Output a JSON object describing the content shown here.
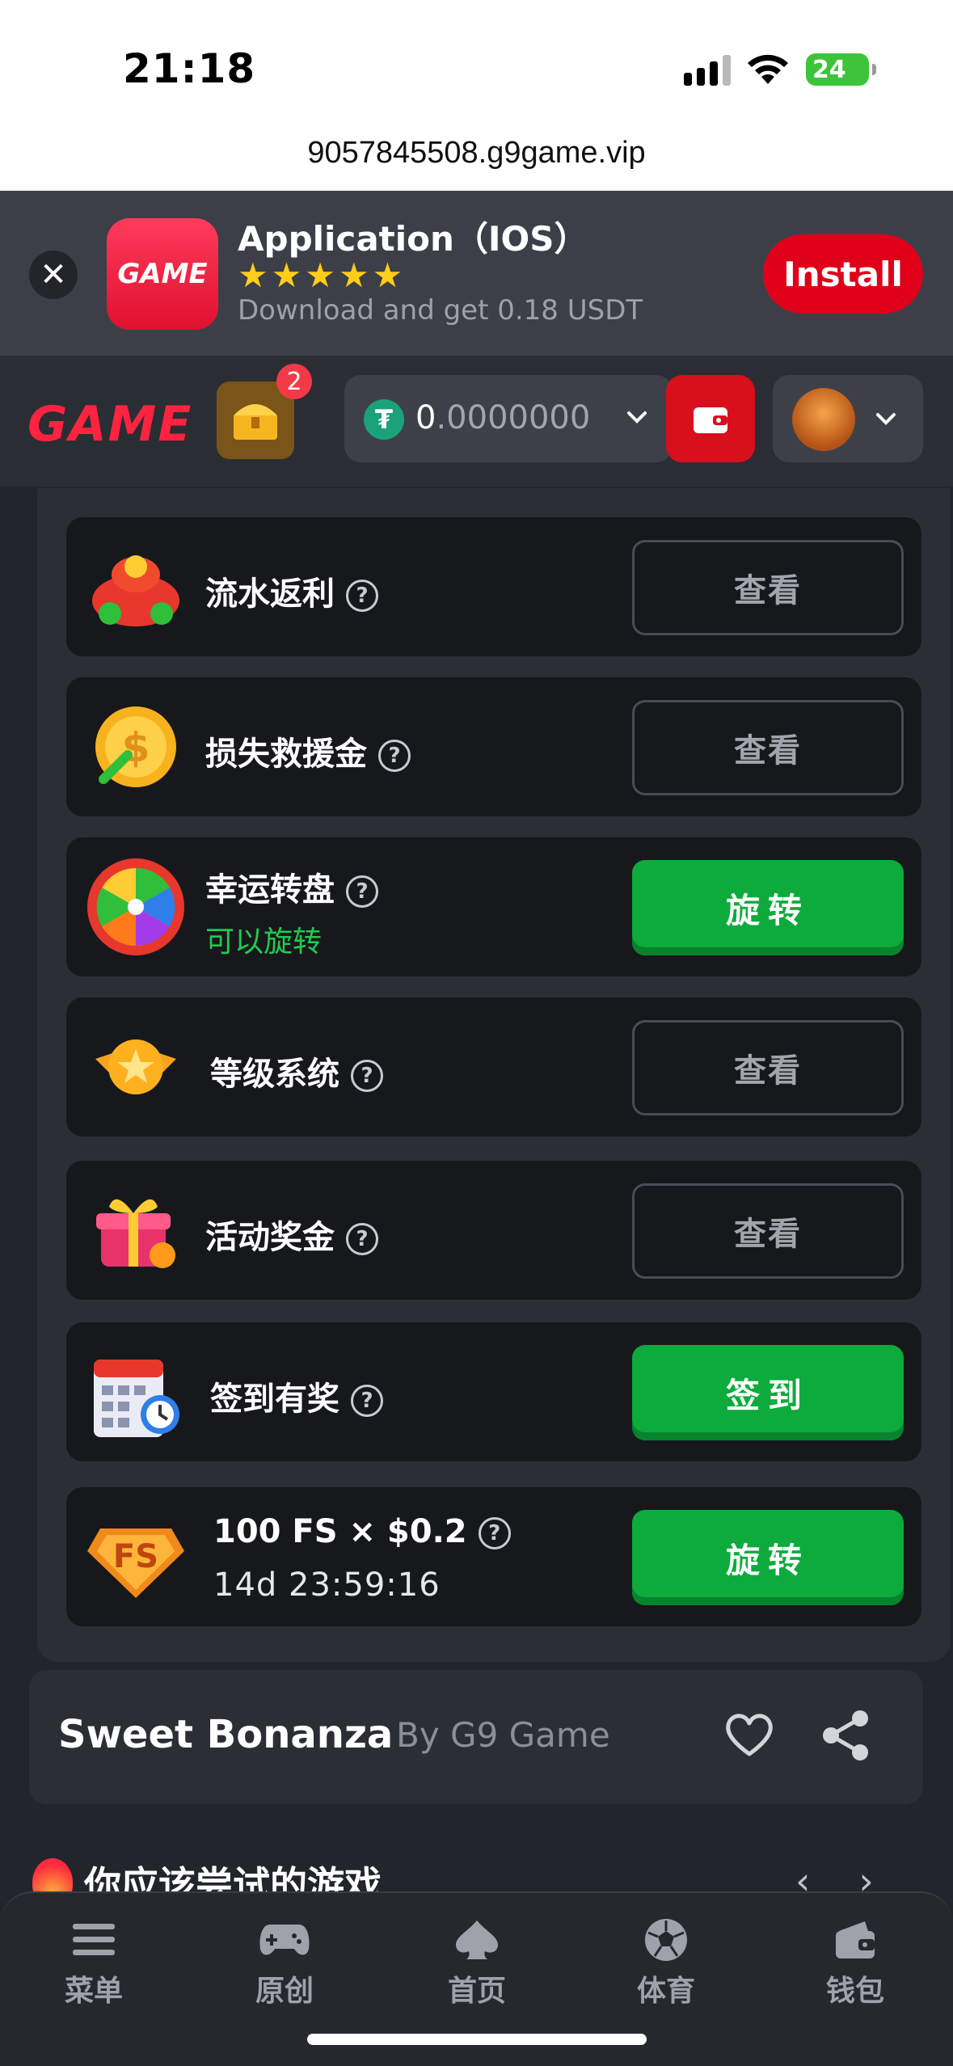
{
  "status_bar": {
    "time": "21:18",
    "battery": "24"
  },
  "url_bar": {
    "url": "9057845508.g9game.vip"
  },
  "install_banner": {
    "icon_text": "GAME",
    "title": "Application（IOS）",
    "stars": "★★★★★",
    "subtitle": "Download and get 0.18 USDT",
    "install_label": "Install",
    "close_glyph": "✕"
  },
  "header": {
    "logo": "GAME",
    "chest_badge": "2",
    "usdt_symbol": "₮",
    "balance_int": "0",
    "balance_frac": ".0000000"
  },
  "rows": [
    {
      "label": "流水返利",
      "button": "查看"
    },
    {
      "label": "损失救援金",
      "button": "查看"
    },
    {
      "label": "幸运转盘",
      "sub": "可以旋转",
      "button": "旋转"
    },
    {
      "label": "等级系统",
      "button": "查看"
    },
    {
      "label": "活动奖金",
      "button": "查看"
    },
    {
      "label": "签到有奖",
      "button": "签到"
    },
    {
      "label": "100 FS × $0.2",
      "timer": "14d 23:59:16",
      "button": "旋转"
    }
  ],
  "help_glyph": "?",
  "fs_badge": "FS",
  "game": {
    "name": "Sweet Bonanza",
    "by": "By G9 Game"
  },
  "try_section": {
    "heading": "你应该尝试的游戏",
    "prev": "‹",
    "next": "›"
  },
  "bottom_nav": [
    {
      "label": "菜单",
      "icon": "menu-icon"
    },
    {
      "label": "原创",
      "icon": "gamepad-icon"
    },
    {
      "label": "首页",
      "icon": "spade-icon"
    },
    {
      "label": "体育",
      "icon": "soccer-ball-icon"
    },
    {
      "label": "钱包",
      "icon": "wallet-icon"
    }
  ],
  "colors": {
    "accent_red": "#e0001a",
    "accent_green": "#0cab3b",
    "bg": "#23252c"
  }
}
